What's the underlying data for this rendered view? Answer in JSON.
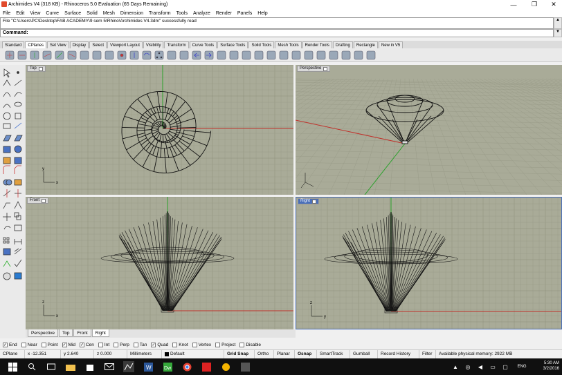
{
  "window": {
    "title": "Archimides V4 (318 KB) - Rhinoceros 5.0 Evaluation (65 Days Remaining)",
    "minimize": "—",
    "maximize": "❐",
    "close": "✕"
  },
  "menu": [
    "File",
    "Edit",
    "View",
    "Curve",
    "Surface",
    "Solid",
    "Mesh",
    "Dimension",
    "Transform",
    "Tools",
    "Analyze",
    "Render",
    "Panels",
    "Help"
  ],
  "command_history": "File \"C:\\Users\\PC\\Desktop\\FAB ACADEMY\\9 sem 5\\Rhino\\Archimides V4.3dm\" successfully read",
  "command_prompt": "Command:",
  "toolbar_tabs": [
    "Standard",
    "CPlanes",
    "Set View",
    "Display",
    "Select",
    "Viewport Layout",
    "Visibility",
    "Transform",
    "Curve Tools",
    "Surface Tools",
    "Solid Tools",
    "Mesh Tools",
    "Render Tools",
    "Drafting",
    "Rectangle",
    "New in V5"
  ],
  "toolbar_active_tab": "CPlanes",
  "viewports": {
    "top": {
      "label": "Top"
    },
    "perspective": {
      "label": "Perspective"
    },
    "front": {
      "label": "Front"
    },
    "right": {
      "label": "Right"
    }
  },
  "axis_labels": {
    "x": "x",
    "y": "y",
    "z": "z"
  },
  "viewport_tabs": [
    "Perspective",
    "Top",
    "Front",
    "Right"
  ],
  "viewport_tabs_active": "Right",
  "osnaps": [
    {
      "label": "End",
      "checked": true
    },
    {
      "label": "Near",
      "checked": false
    },
    {
      "label": "Point",
      "checked": false
    },
    {
      "label": "Mid",
      "checked": true
    },
    {
      "label": "Cen",
      "checked": true
    },
    {
      "label": "Int",
      "checked": false
    },
    {
      "label": "Perp",
      "checked": false
    },
    {
      "label": "Tan",
      "checked": false
    },
    {
      "label": "Quad",
      "checked": true
    },
    {
      "label": "Knot",
      "checked": false
    },
    {
      "label": "Vertex",
      "checked": false
    },
    {
      "label": "Project",
      "checked": false
    },
    {
      "label": "Disable",
      "checked": false
    }
  ],
  "status": {
    "cplane": "CPlane",
    "x": "x -12.351",
    "y": "y 2.640",
    "z": "z 0.000",
    "units": "Millimeters",
    "layer": "Default",
    "grid_snap": "Grid Snap",
    "ortho": "Ortho",
    "planar": "Planar",
    "osnap": "Osnap",
    "smarttrack": "SmartTrack",
    "gumball": "Gumball",
    "record_history": "Record History",
    "filter": "Filter",
    "memory": "Available physical memory: 2922 MB"
  },
  "taskbar": {
    "time": "5:30 AM",
    "date": "3/2/2016",
    "lang": "ENG"
  },
  "colors": {
    "viewport_bg": "#a9ab98",
    "grid_minor": "#9a9c89",
    "grid_major": "#8c8e7b",
    "x_axis": "#c0302a",
    "y_axis": "#2aa12a",
    "active_viewport": "#4a6fb8"
  }
}
